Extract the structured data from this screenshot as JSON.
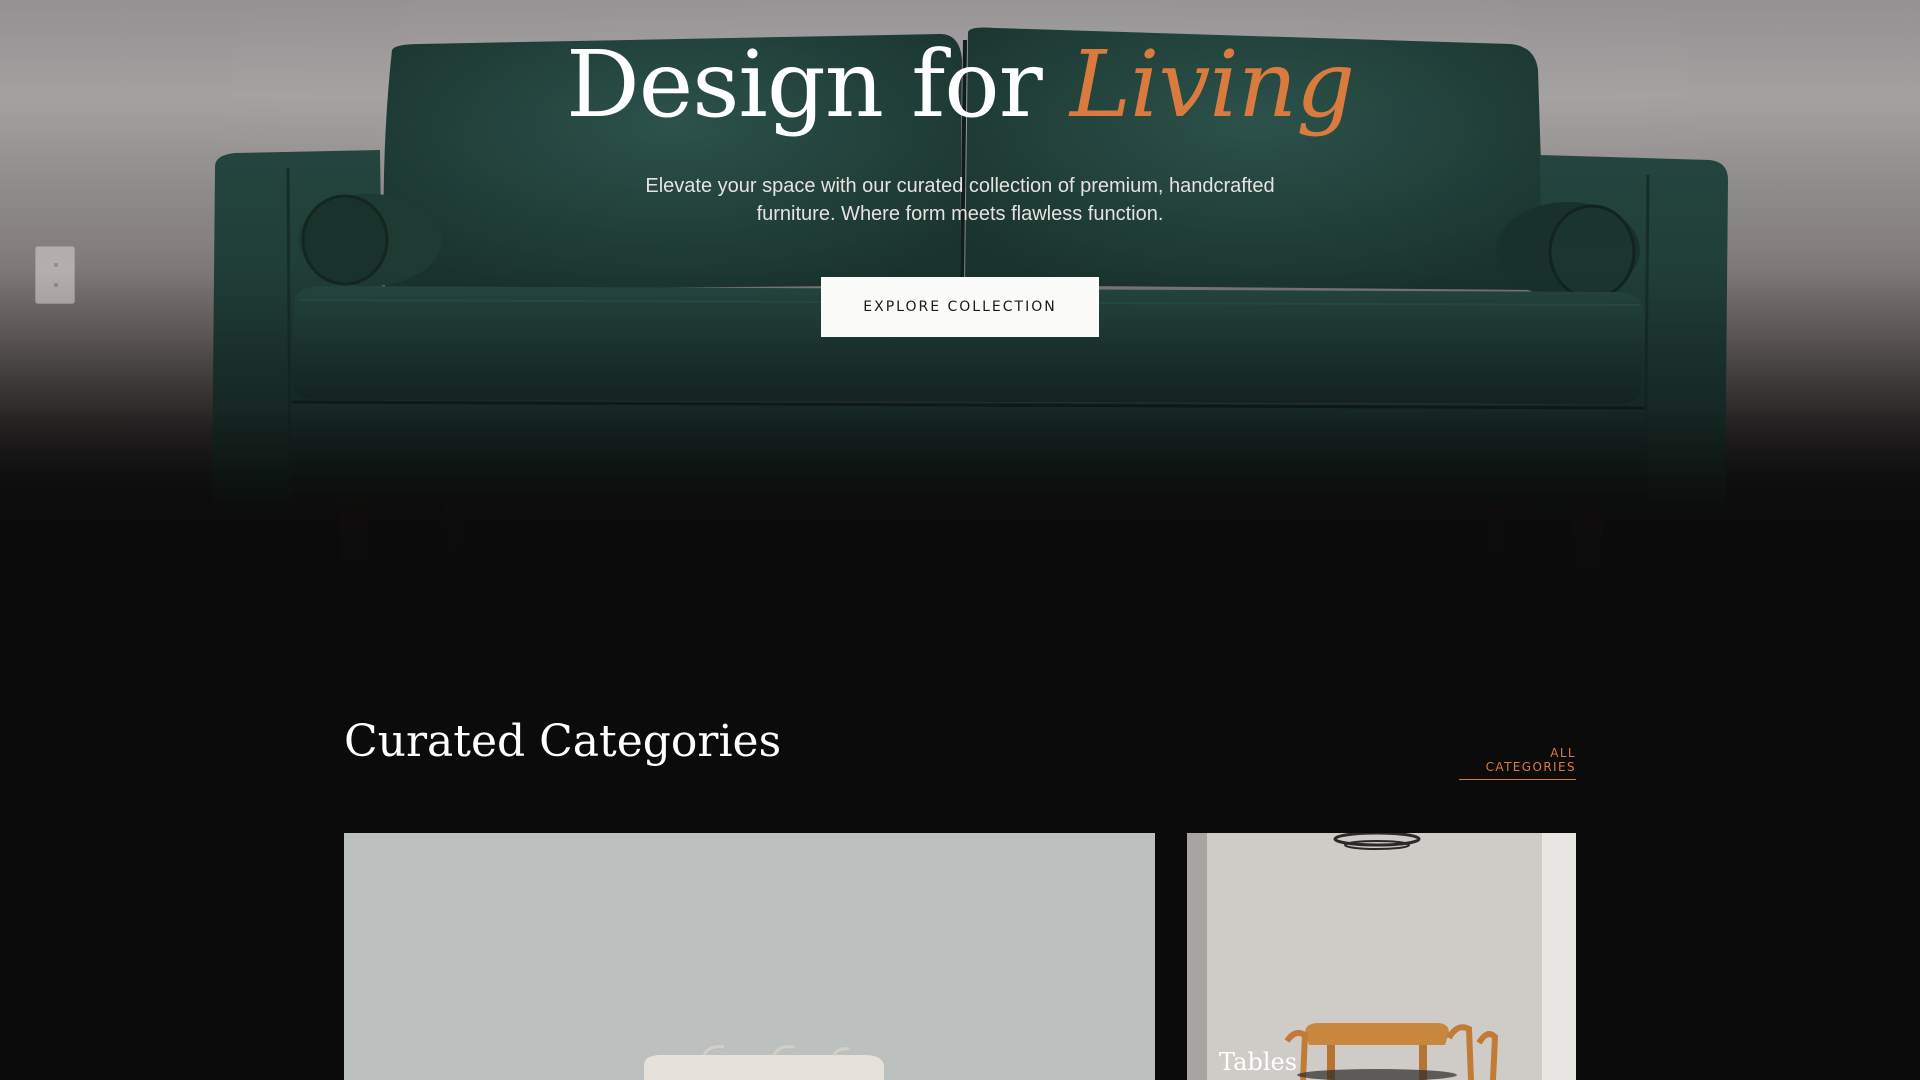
{
  "hero": {
    "title_main": "Design for ",
    "title_accent": "Living",
    "subtitle": "Elevate your space with our curated collection of premium, handcrafted furniture. Where form meets flawless function.",
    "cta_label": "EXPLORE COLLECTION"
  },
  "categories": {
    "heading": "Curated Categories",
    "all_link": "ALL CATEGORIES",
    "cards": [
      {
        "label": ""
      },
      {
        "label": "Tables"
      }
    ]
  },
  "colors": {
    "accent": "#d97a3e",
    "background": "#0b0b0b",
    "sofa": "#1f3c36"
  }
}
